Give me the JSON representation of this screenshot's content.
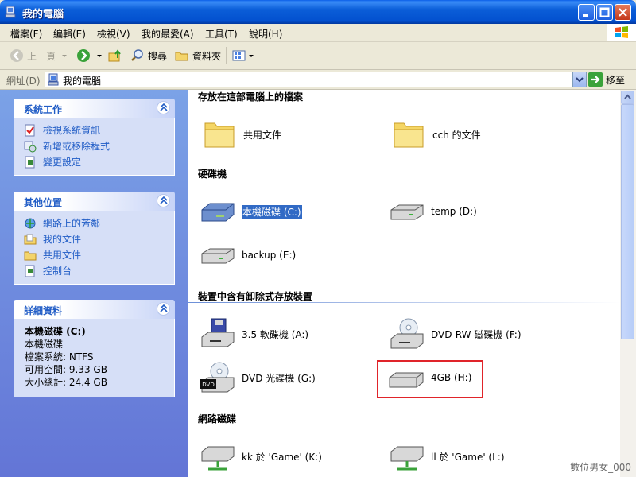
{
  "window": {
    "title": "我的電腦"
  },
  "menu": [
    "檔案(F)",
    "編輯(E)",
    "檢視(V)",
    "我的最愛(A)",
    "工具(T)",
    "說明(H)"
  ],
  "toolbar": {
    "back": "上一頁",
    "search": "搜尋",
    "folders": "資料夾"
  },
  "address": {
    "label": "網址(D)",
    "value": "我的電腦",
    "go": "移至"
  },
  "tasks": {
    "system": {
      "title": "系統工作",
      "items": [
        "檢視系統資訊",
        "新增或移除程式",
        "變更設定"
      ]
    },
    "other": {
      "title": "其他位置",
      "items": [
        "網路上的芳鄰",
        "我的文件",
        "共用文件",
        "控制台"
      ]
    },
    "details": {
      "title": "詳細資料",
      "name": "本機磁碟 (C:)",
      "type": "本機磁碟",
      "fs": "檔案系統: NTFS",
      "free": "可用空間: 9.33 GB",
      "total": "大小總計: 24.4 GB"
    }
  },
  "groups": {
    "files": {
      "title": "存放在這部電腦上的檔案",
      "items": [
        "共用文件",
        "cch 的文件"
      ]
    },
    "hdd": {
      "title": "硬碟機",
      "items": [
        "本機磁碟 (C:)",
        "temp (D:)",
        "backup (E:)"
      ]
    },
    "removable": {
      "title": "裝置中含有卸除式存放裝置",
      "items": [
        "3.5 軟碟機 (A:)",
        "DVD-RW 磁碟機 (F:)",
        "DVD 光碟機 (G:)",
        "4GB (H:)"
      ]
    },
    "network": {
      "title": "網路磁碟",
      "items": [
        "kk 於 'Game' (K:)",
        "ll 於 'Game' (L:)"
      ]
    }
  },
  "watermark": "數位男女_000",
  "colors": {
    "titlebar": "#0a5ee8",
    "taskpane": "#7ba2e7",
    "link": "#215dc6",
    "selection": "#316ac5",
    "highlight": "#e0242a"
  }
}
